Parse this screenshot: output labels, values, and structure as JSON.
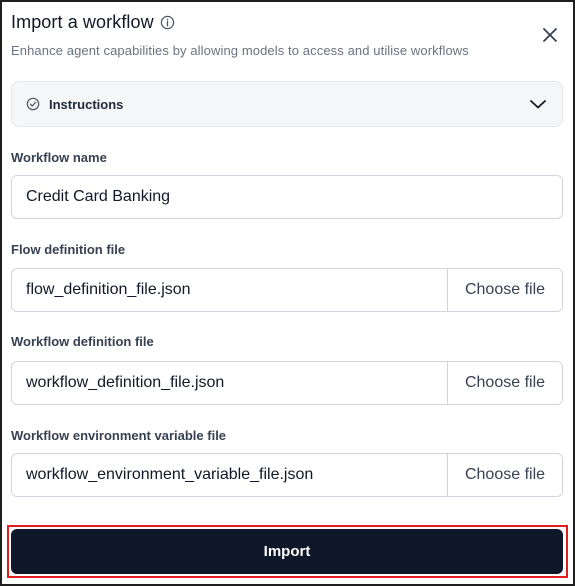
{
  "dialog": {
    "title": "Import a workflow",
    "subtitle": "Enhance agent capabilities by allowing models to access and utilise workflows"
  },
  "instructions": {
    "label": "Instructions"
  },
  "workflow_name": {
    "label": "Workflow name",
    "value": "Credit Card Banking"
  },
  "flow_definition": {
    "label": "Flow definition file",
    "file_name": "flow_definition_file.json",
    "button_label": "Choose file"
  },
  "workflow_definition": {
    "label": "Workflow definition file",
    "file_name": "workflow_definition_file.json",
    "button_label": "Choose file"
  },
  "workflow_env": {
    "label": "Workflow environment variable file",
    "file_name": "workflow_environment_variable_file.json",
    "button_label": "Choose file"
  },
  "actions": {
    "import_label": "Import"
  },
  "icons": {
    "info": "info-icon",
    "close": "close-icon",
    "check": "check-circle-icon",
    "chevron": "chevron-down-icon"
  },
  "colors": {
    "primary_button": "#0f172a",
    "highlight_outline": "#e01e1e",
    "accordion_bg": "#f5f6f8"
  }
}
